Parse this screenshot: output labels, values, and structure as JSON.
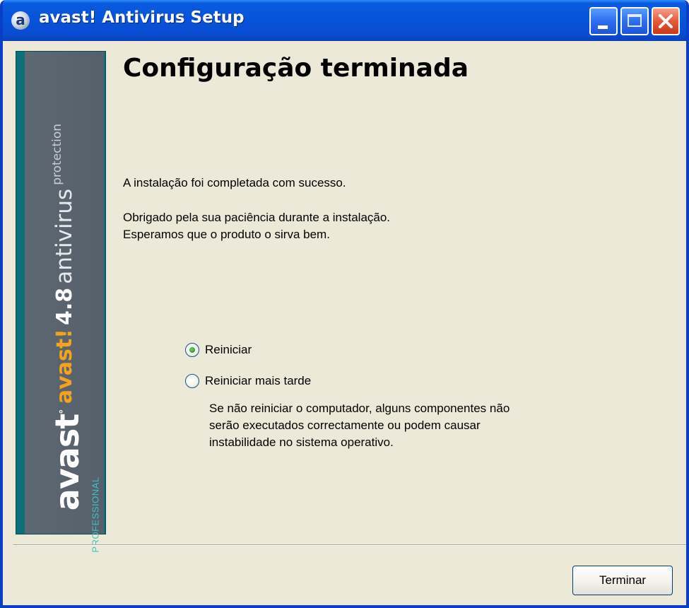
{
  "window": {
    "title": "avast! Antivirus Setup",
    "icon": "avast-logo-icon",
    "controls": [
      "minimize-icon",
      "maximize-icon",
      "close-icon"
    ]
  },
  "sidebar": {
    "brand": "avast!",
    "version": "4.8",
    "product": "antivirus",
    "tagline": "protection",
    "logo": "avast",
    "edition": "PROFESSIONAL"
  },
  "page": {
    "heading": "Configuração terminada",
    "line1": "A instalação foi completada com sucesso.",
    "line2": "Obrigado pela sua paciência durante a instalação.",
    "line3": "Esperamos que o produto o sirva bem."
  },
  "options": {
    "restart_now": {
      "label": "Reiniciar",
      "checked": true
    },
    "restart_later": {
      "label": "Reiniciar mais tarde",
      "checked": false
    },
    "note_line1": "Se não reiniciar o computador, alguns componentes não",
    "note_line2": "serão executados correctamente ou podem causar",
    "note_line3": "instabilidade no sistema operativo."
  },
  "buttons": {
    "finish": "Terminar"
  },
  "colors": {
    "titlebar": "#0654DA",
    "dialog_bg": "#ECE9D8",
    "brand_orange": "#F5A21C",
    "sidebar_teal": "#0E6E7A",
    "sidebar_gray": "#5E6872"
  }
}
